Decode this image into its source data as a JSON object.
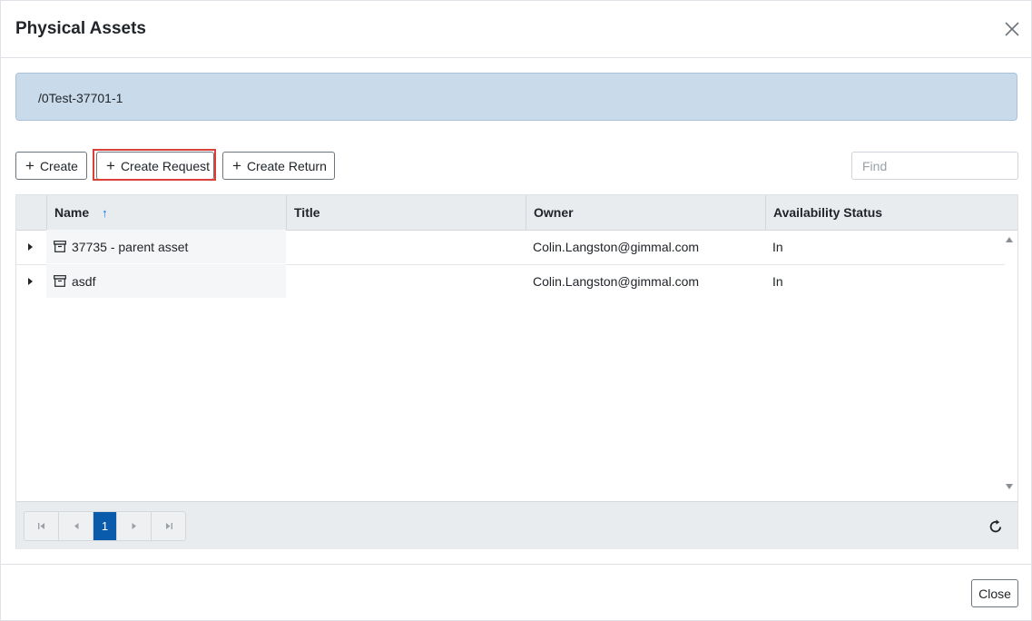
{
  "dialog": {
    "title": "Physical Assets",
    "close_label": "Close"
  },
  "path": "/0Test-37701-1",
  "toolbar": {
    "create_label": "Create",
    "create_request_label": "Create Request",
    "create_return_label": "Create Return",
    "find_placeholder": "Find"
  },
  "grid": {
    "columns": [
      "Name",
      "Title",
      "Owner",
      "Availability Status"
    ],
    "rows": [
      {
        "name": "37735 - parent asset",
        "title": "",
        "owner": "Colin.Langston@gimmal.com",
        "status": "In"
      },
      {
        "name": "asdf",
        "title": "",
        "owner": "Colin.Langston@gimmal.com",
        "status": "In"
      }
    ]
  },
  "pager": {
    "current_page": "1"
  },
  "colors": {
    "accent": "#0a5bab",
    "highlight": "#d9403a",
    "path_bg": "#c9dbeb",
    "header_bg": "#e9ecef"
  }
}
